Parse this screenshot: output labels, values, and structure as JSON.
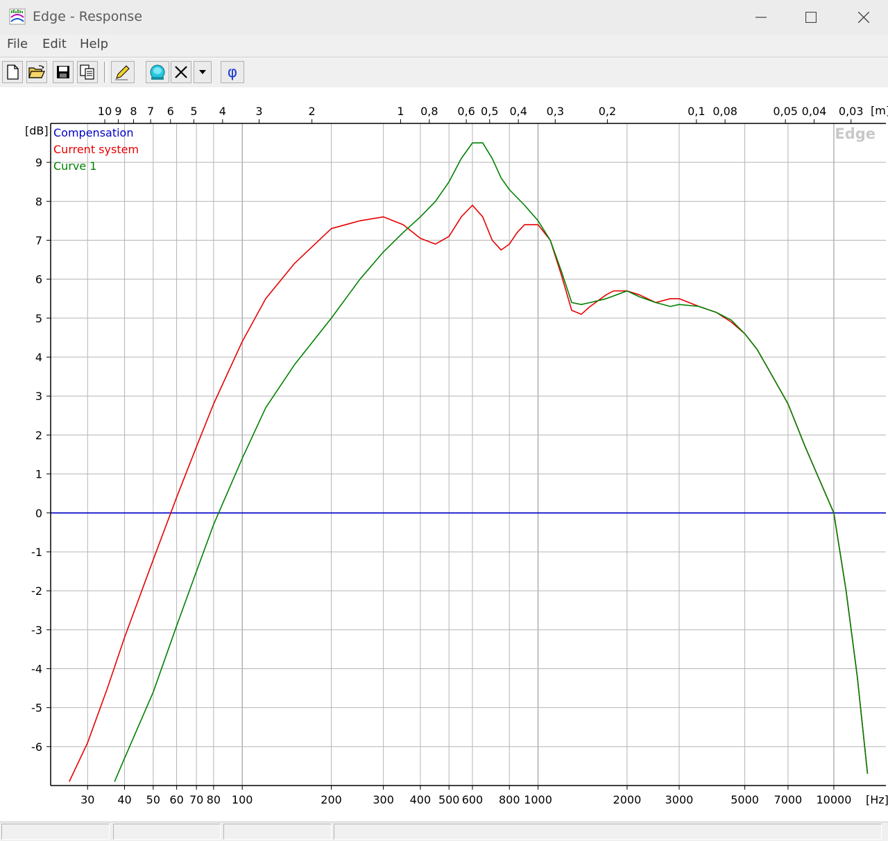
{
  "window": {
    "title": "Edge - Response",
    "minimize_icon": "minimize-icon",
    "maximize_icon": "maximize-icon",
    "close_icon": "close-icon"
  },
  "menu": [
    "File",
    "Edit",
    "Help"
  ],
  "toolbar": {
    "buttons": [
      "new-file-icon",
      "open-folder-icon",
      "save-disk-icon",
      "copy-icon",
      "pencil-icon",
      "speaker-icon",
      "delete-x-icon",
      "dropdown-arrow-icon",
      "phi-icon"
    ],
    "phi_label": "φ"
  },
  "chart_data": {
    "type": "line",
    "watermark": "Edge",
    "x_scale": "log",
    "xlim": [
      22.5,
      15000
    ],
    "ylim": [
      -7,
      10
    ],
    "grid": true,
    "legend_position": "top-left",
    "y_unit_label": "[dB]",
    "x_unit_label": "[Hz]",
    "top_unit_label": "[m]",
    "x_ticks": [
      30,
      40,
      50,
      60,
      70,
      80,
      100,
      200,
      300,
      400,
      500,
      600,
      800,
      1000,
      2000,
      3000,
      5000,
      7000,
      10000
    ],
    "x_tick_labels": [
      "30",
      "40",
      "50",
      "60",
      "70",
      "80",
      "100",
      "200",
      "300",
      "400",
      "500",
      "600",
      "800",
      "1000",
      "2000",
      "3000",
      "5000",
      "7000",
      "10000"
    ],
    "y_ticks": [
      9,
      8,
      7,
      6,
      5,
      4,
      3,
      2,
      1,
      0,
      -1,
      -2,
      -3,
      -4,
      -5,
      -6
    ],
    "y_tick_labels": [
      "9",
      "8",
      "7",
      "6",
      "5",
      "4",
      "3",
      "2",
      "1",
      "0",
      "-1",
      "-2",
      "-3",
      "-4",
      "-5",
      "-6"
    ],
    "top_ticks": [
      {
        "label": "10",
        "f": 34.3
      },
      {
        "label": "9",
        "f": 38.1
      },
      {
        "label": "8",
        "f": 42.9
      },
      {
        "label": "7",
        "f": 49
      },
      {
        "label": "6",
        "f": 57.2
      },
      {
        "label": "5",
        "f": 68.6
      },
      {
        "label": "4",
        "f": 85.8
      },
      {
        "label": "3",
        "f": 114
      },
      {
        "label": "2",
        "f": 172
      },
      {
        "label": "1",
        "f": 343
      },
      {
        "label": "0,8",
        "f": 429
      },
      {
        "label": "0,6",
        "f": 572
      },
      {
        "label": "0,5",
        "f": 686
      },
      {
        "label": "0,4",
        "f": 858
      },
      {
        "label": "0,3",
        "f": 1143
      },
      {
        "label": "0,2",
        "f": 1715
      },
      {
        "label": "0,1",
        "f": 3430
      },
      {
        "label": "0,08",
        "f": 4288
      },
      {
        "label": "0,05",
        "f": 6860
      },
      {
        "label": "0,04",
        "f": 8575
      },
      {
        "label": "0,03",
        "f": 11433
      }
    ],
    "series": [
      {
        "name": "Compensation",
        "color": "#0000c8",
        "x": [
          22.5,
          15000
        ],
        "y": [
          0,
          0
        ]
      },
      {
        "name": "Current system",
        "color": "#e60000",
        "x": [
          26,
          30,
          35,
          40,
          50,
          60,
          70,
          80,
          100,
          120,
          150,
          200,
          250,
          300,
          350,
          400,
          450,
          500,
          550,
          600,
          650,
          700,
          750,
          800,
          850,
          900,
          1000,
          1100,
          1200,
          1300,
          1400,
          1500,
          1700,
          1800,
          2000,
          2200,
          2500,
          2800,
          3000,
          3500,
          4000,
          4500,
          5000,
          5500,
          6000,
          7000,
          8000,
          9000,
          10000,
          11000,
          12000,
          13000
        ],
        "y": [
          -6.9,
          -5.9,
          -4.5,
          -3.2,
          -1.2,
          0.4,
          1.7,
          2.8,
          4.4,
          5.5,
          6.4,
          7.3,
          7.5,
          7.6,
          7.4,
          7.05,
          6.9,
          7.1,
          7.6,
          7.9,
          7.6,
          7.0,
          6.75,
          6.9,
          7.2,
          7.4,
          7.4,
          7.0,
          6.1,
          5.2,
          5.1,
          5.3,
          5.6,
          5.7,
          5.7,
          5.6,
          5.4,
          5.5,
          5.5,
          5.3,
          5.15,
          4.9,
          4.6,
          4.2,
          3.7,
          2.8,
          1.7,
          0.8,
          0.0,
          -2.0,
          -4.2,
          -6.7
        ]
      },
      {
        "name": "Curve 1",
        "color": "#008000",
        "x": [
          37,
          40,
          50,
          60,
          70,
          80,
          100,
          120,
          150,
          200,
          250,
          300,
          350,
          400,
          450,
          500,
          550,
          600,
          650,
          700,
          750,
          800,
          900,
          1000,
          1100,
          1200,
          1300,
          1400,
          1500,
          1700,
          2000,
          2200,
          2500,
          2800,
          3000,
          3500,
          4000,
          4500,
          5000,
          5500,
          6000,
          7000,
          8000,
          9000,
          10000,
          11000,
          12000,
          13000
        ],
        "y": [
          -6.9,
          -6.3,
          -4.6,
          -2.9,
          -1.5,
          -0.3,
          1.4,
          2.7,
          3.8,
          5.0,
          6.0,
          6.7,
          7.2,
          7.6,
          8.0,
          8.5,
          9.1,
          9.5,
          9.5,
          9.1,
          8.6,
          8.3,
          7.9,
          7.5,
          7.0,
          6.2,
          5.4,
          5.35,
          5.4,
          5.5,
          5.7,
          5.55,
          5.4,
          5.3,
          5.35,
          5.3,
          5.15,
          4.95,
          4.6,
          4.2,
          3.7,
          2.8,
          1.7,
          0.8,
          0.0,
          -2.0,
          -4.2,
          -6.7
        ]
      }
    ]
  }
}
